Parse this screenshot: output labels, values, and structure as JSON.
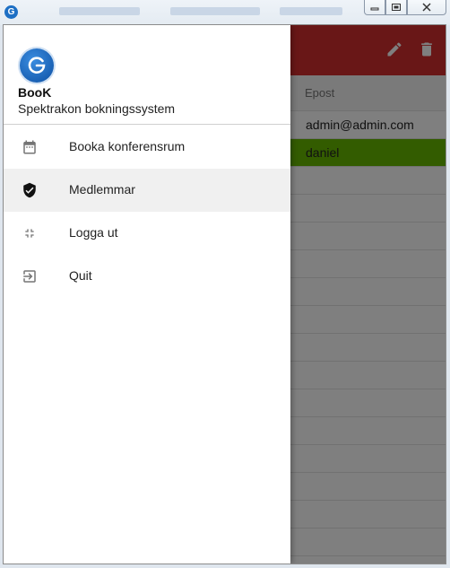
{
  "window": {
    "app_icon_letter": "G",
    "controls": {
      "minimize_icon": "minimize-icon",
      "restore_icon": "restore-icon",
      "close_icon": "close-icon"
    }
  },
  "appbar": {
    "color": "#d32f2f",
    "actions": [
      {
        "icon": "edit-icon"
      },
      {
        "icon": "delete-icon"
      }
    ]
  },
  "table": {
    "column_header": "Epost",
    "rows": [
      "admin@admin.com",
      "daniel",
      "",
      "",
      "",
      "",
      "",
      "",
      "",
      "",
      "",
      "",
      "",
      "",
      "",
      ""
    ],
    "selected_row_color": "#66b800"
  },
  "drawer": {
    "logo_letter": "G",
    "title": "BooK",
    "subtitle": "Spektrakon bokningssystem",
    "items": [
      {
        "label": "Booka konferensrum",
        "icon": "calendar-icon"
      },
      {
        "label": "Medlemmar",
        "icon": "shield-check-icon"
      },
      {
        "label": "Logga ut",
        "icon": "fullscreen-exit-icon"
      },
      {
        "label": "Quit",
        "icon": "exit-to-app-icon"
      }
    ]
  }
}
